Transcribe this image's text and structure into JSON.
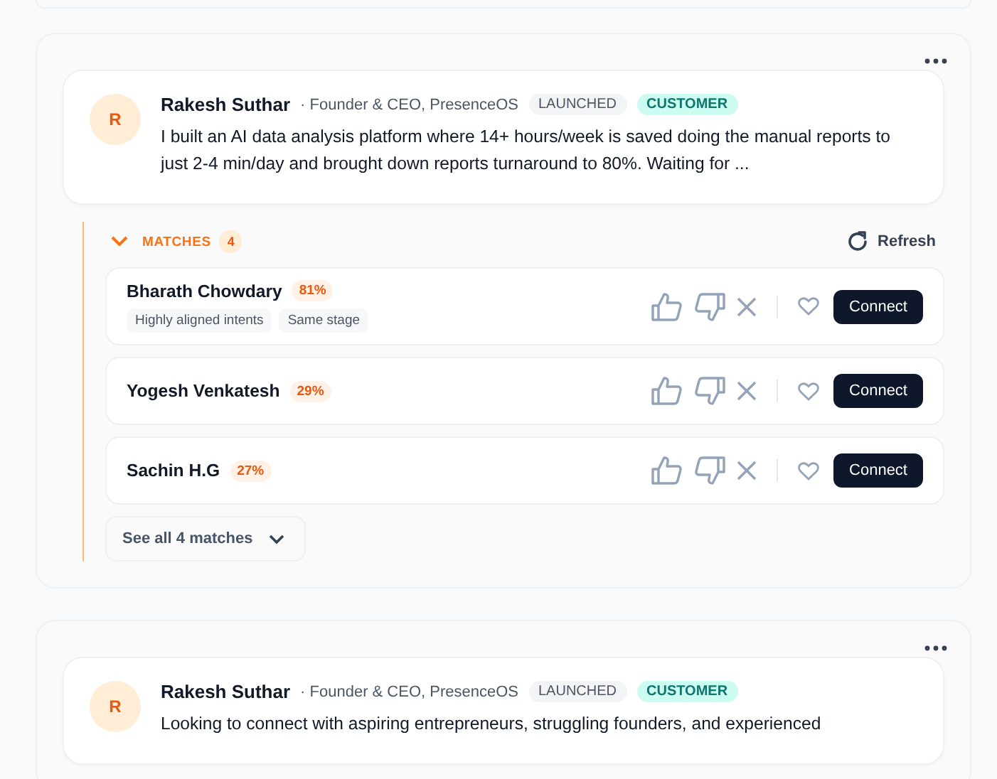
{
  "posts": [
    {
      "avatar": "R",
      "author": "Rakesh Suthar",
      "role": "· Founder & CEO, PresenceOS",
      "tags": [
        {
          "label": "LAUNCHED",
          "kind": "stage"
        },
        {
          "label": "CUSTOMER",
          "kind": "customer"
        }
      ],
      "text": "I built an AI data analysis platform where 14+ hours/week is saved doing the manual reports to just 2-4 min/day and brought down reports turnaround to 80%. Waiting for ...",
      "matches": {
        "label": "MATCHES",
        "count": "4",
        "expanded": true,
        "refresh": "Refresh",
        "see_all": "See all 4 matches",
        "items": [
          {
            "name": "Bharath Chowdary",
            "score": "81%",
            "reasons": [
              "Highly aligned intents",
              "Same stage"
            ],
            "action": "Connect"
          },
          {
            "name": "Yogesh Venkatesh",
            "score": "29%",
            "action": "Connect"
          },
          {
            "name": "Sachin H.G",
            "score": "27%",
            "action": "Connect"
          }
        ]
      }
    },
    {
      "avatar": "R",
      "author": "Rakesh Suthar",
      "role": "· Founder & CEO, PresenceOS",
      "tags": [
        {
          "label": "LAUNCHED",
          "kind": "stage"
        },
        {
          "label": "CUSTOMER",
          "kind": "customer"
        }
      ],
      "text": "Looking to connect with aspiring entrepreneurs, struggling founders, and experienced"
    }
  ]
}
